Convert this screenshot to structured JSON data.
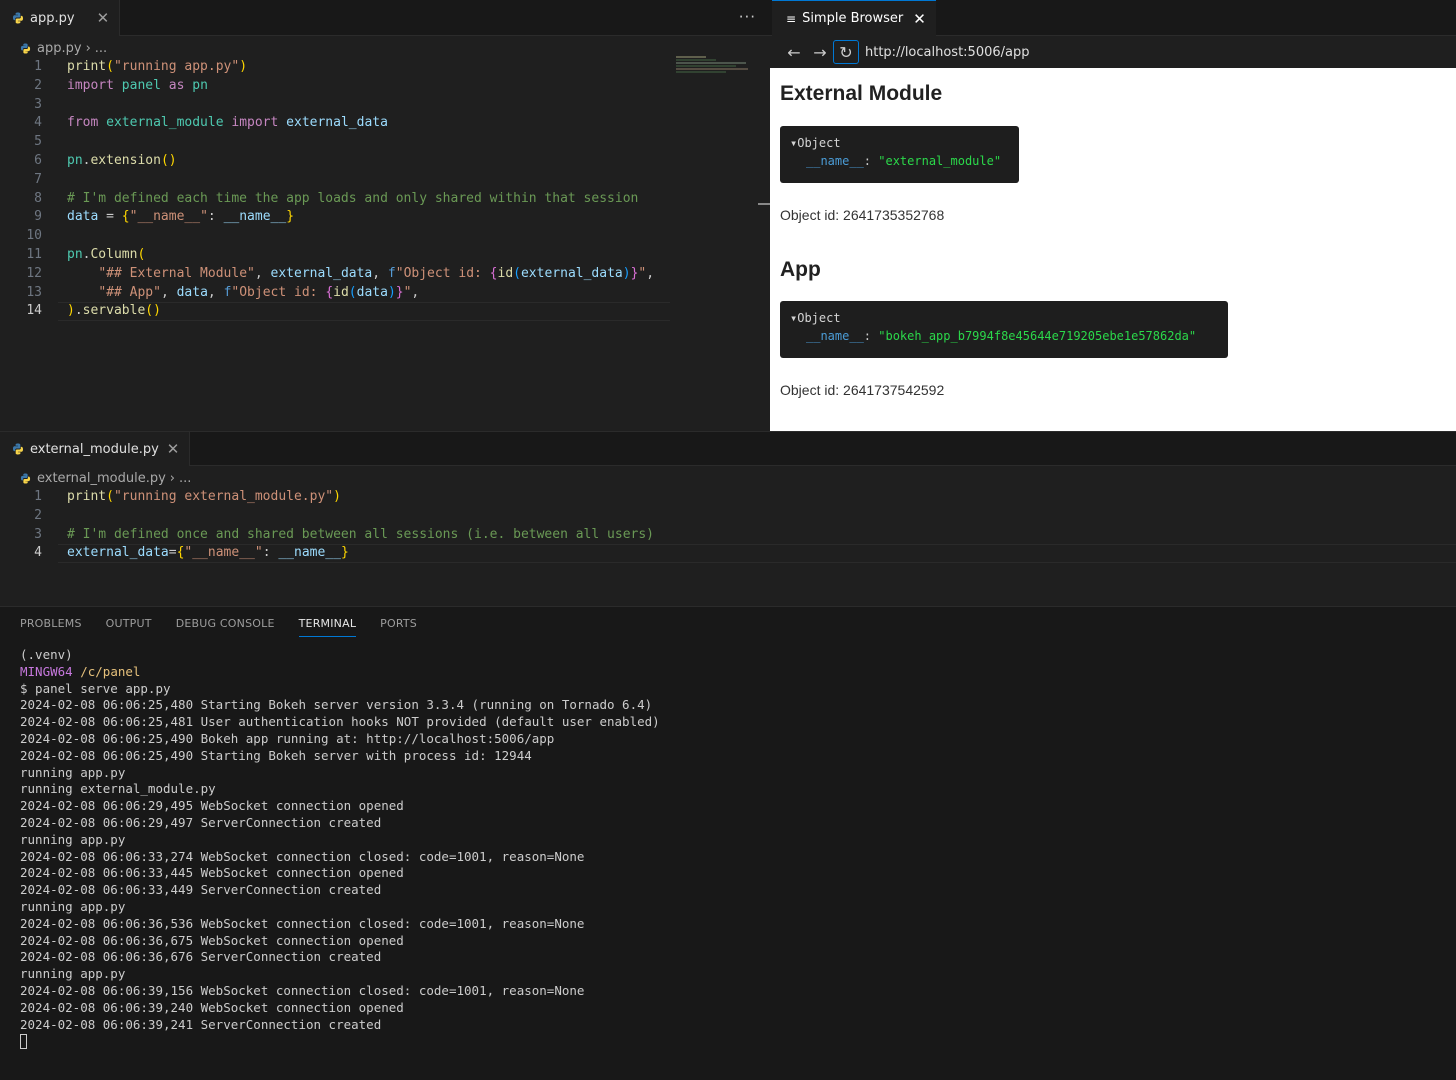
{
  "editor_top": {
    "tab_label": "app.py",
    "more_label": "···",
    "breadcrumb_file": "app.py",
    "breadcrumb_rest": "...",
    "lines": [
      {
        "n": "1"
      },
      {
        "n": "2"
      },
      {
        "n": "3"
      },
      {
        "n": "4"
      },
      {
        "n": "5"
      },
      {
        "n": "6"
      },
      {
        "n": "7"
      },
      {
        "n": "8"
      },
      {
        "n": "9"
      },
      {
        "n": "10"
      },
      {
        "n": "11"
      },
      {
        "n": "12"
      },
      {
        "n": "13"
      },
      {
        "n": "14"
      }
    ],
    "code": {
      "l1_fn": "print",
      "l1_str": "\"running app.py\"",
      "l2_kw": "import",
      "l2_mod": "panel",
      "l2_as": "as",
      "l2_alias": "pn",
      "l4_from": "from",
      "l4_mod": "external_module",
      "l4_import": "import",
      "l4_name": "external_data",
      "l6_obj": "pn",
      "l6_fn": "extension",
      "l8_comment": "# I'm defined each time the app loads and only shared within that session",
      "l9_var": "data",
      "l9_key": "\"__name__\"",
      "l9_val": "__name__",
      "l11_obj": "pn",
      "l11_fn": "Column",
      "l12_s1": "\"## External Module\"",
      "l12_var": "external_data",
      "l12_f": "f",
      "l12_s2": "\"Object id: ",
      "l12_id": "id",
      "l12_arg": "external_data",
      "l12_end": "\"",
      "l13_s1": "\"## App\"",
      "l13_var": "data",
      "l13_f": "f",
      "l13_s2": "\"Object id: ",
      "l13_id": "id",
      "l13_arg": "data",
      "l13_end": "\"",
      "l14_fn": "servable"
    }
  },
  "browser": {
    "tab_label": "Simple Browser",
    "url": "http://localhost:5006/app",
    "sections": [
      {
        "heading": "External Module",
        "object_label": "Object",
        "key": "__name__",
        "value": "\"external_module\"",
        "object_id": "Object id: 2641735352768"
      },
      {
        "heading": "App",
        "object_label": "Object",
        "key": "__name__",
        "value": "\"bokeh_app_b7994f8e45644e719205ebe1e57862da\"",
        "object_id": "Object id: 2641737542592"
      }
    ]
  },
  "editor_bottom": {
    "tab_label": "external_module.py",
    "breadcrumb_file": "external_module.py",
    "breadcrumb_rest": "...",
    "lines": [
      {
        "n": "1"
      },
      {
        "n": "2"
      },
      {
        "n": "3"
      },
      {
        "n": "4"
      }
    ],
    "code": {
      "l1_fn": "print",
      "l1_str": "\"running external_module.py\"",
      "l3_comment": "# I'm defined once and shared between all sessions (i.e. between all users)",
      "l4_var": "external_data",
      "l4_key": "\"__name__\"",
      "l4_val": "__name__"
    }
  },
  "panel": {
    "tabs": [
      "PROBLEMS",
      "OUTPUT",
      "DEBUG CONSOLE",
      "TERMINAL",
      "PORTS"
    ],
    "active_tab": "TERMINAL",
    "venv": "(.venv)",
    "mingw": "MINGW64",
    "cwd": "/c/panel",
    "command": "$ panel serve app.py",
    "log": [
      "2024-02-08 06:06:25,480 Starting Bokeh server version 3.3.4 (running on Tornado 6.4)",
      "2024-02-08 06:06:25,481 User authentication hooks NOT provided (default user enabled)",
      "2024-02-08 06:06:25,490 Bokeh app running at: http://localhost:5006/app",
      "2024-02-08 06:06:25,490 Starting Bokeh server with process id: 12944",
      "running app.py",
      "running external_module.py",
      "2024-02-08 06:06:29,495 WebSocket connection opened",
      "2024-02-08 06:06:29,497 ServerConnection created",
      "running app.py",
      "2024-02-08 06:06:33,274 WebSocket connection closed: code=1001, reason=None",
      "2024-02-08 06:06:33,445 WebSocket connection opened",
      "2024-02-08 06:06:33,449 ServerConnection created",
      "running app.py",
      "2024-02-08 06:06:36,536 WebSocket connection closed: code=1001, reason=None",
      "2024-02-08 06:06:36,675 WebSocket connection opened",
      "2024-02-08 06:06:36,676 ServerConnection created",
      "running app.py",
      "2024-02-08 06:06:39,156 WebSocket connection closed: code=1001, reason=None",
      "2024-02-08 06:06:39,240 WebSocket connection opened",
      "2024-02-08 06:06:39,241 ServerConnection created"
    ]
  },
  "icons": {
    "python_file": "python-icon",
    "close": "close-icon",
    "back": "arrow-left-icon",
    "forward": "arrow-right-icon",
    "reload": "reload-icon",
    "browser_tab": "browser-icon"
  }
}
